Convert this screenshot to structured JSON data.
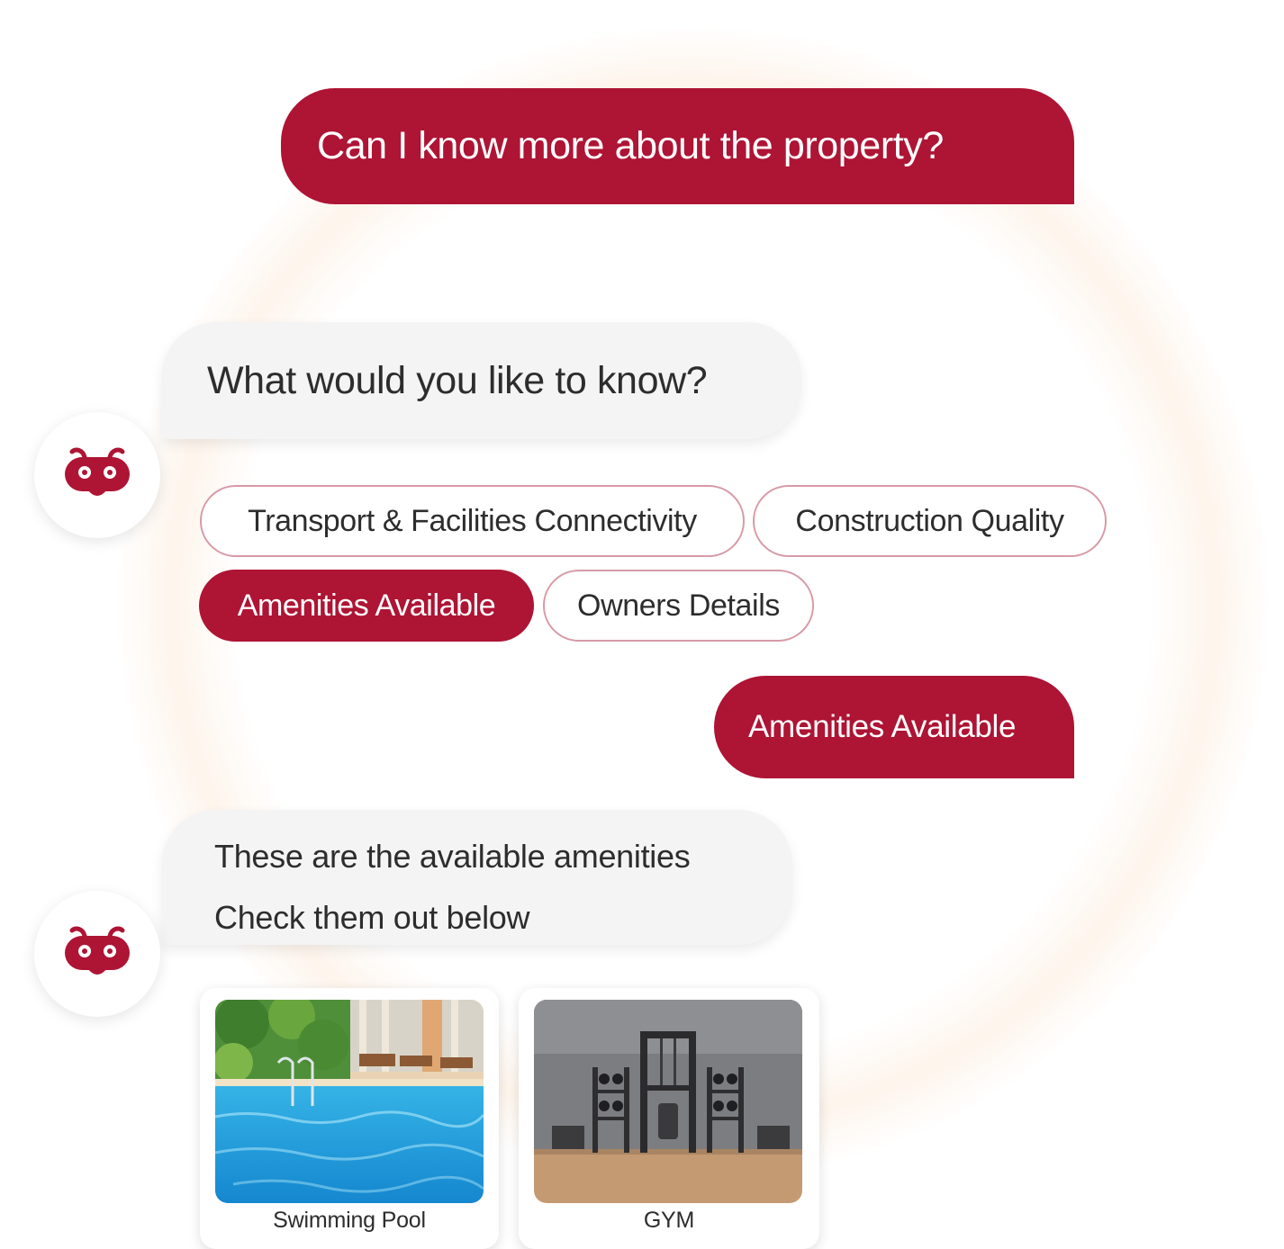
{
  "colors": {
    "accent": "#ae1434",
    "bot_bubble": "#f4f4f5",
    "chip_border": "#d79aa7"
  },
  "conversation": {
    "user_question": "Can I know more about the property?",
    "bot_prompt": "What would you like to know?",
    "options": [
      {
        "label": "Transport & Facilities Connectivity",
        "selected": false
      },
      {
        "label": "Construction Quality",
        "selected": false
      },
      {
        "label": "Amenities Available",
        "selected": true
      },
      {
        "label": "Owners Details",
        "selected": false
      }
    ],
    "user_reply": "Amenities Available",
    "bot_reply_line1": "These are the available amenities",
    "bot_reply_line2": "Check them out below",
    "amenities": [
      {
        "label": "Swimming Pool",
        "image_icon": "swimming-pool-photo"
      },
      {
        "label": "GYM",
        "image_icon": "gym-photo"
      }
    ]
  },
  "icons": {
    "bot_avatar": "robot-icon"
  }
}
